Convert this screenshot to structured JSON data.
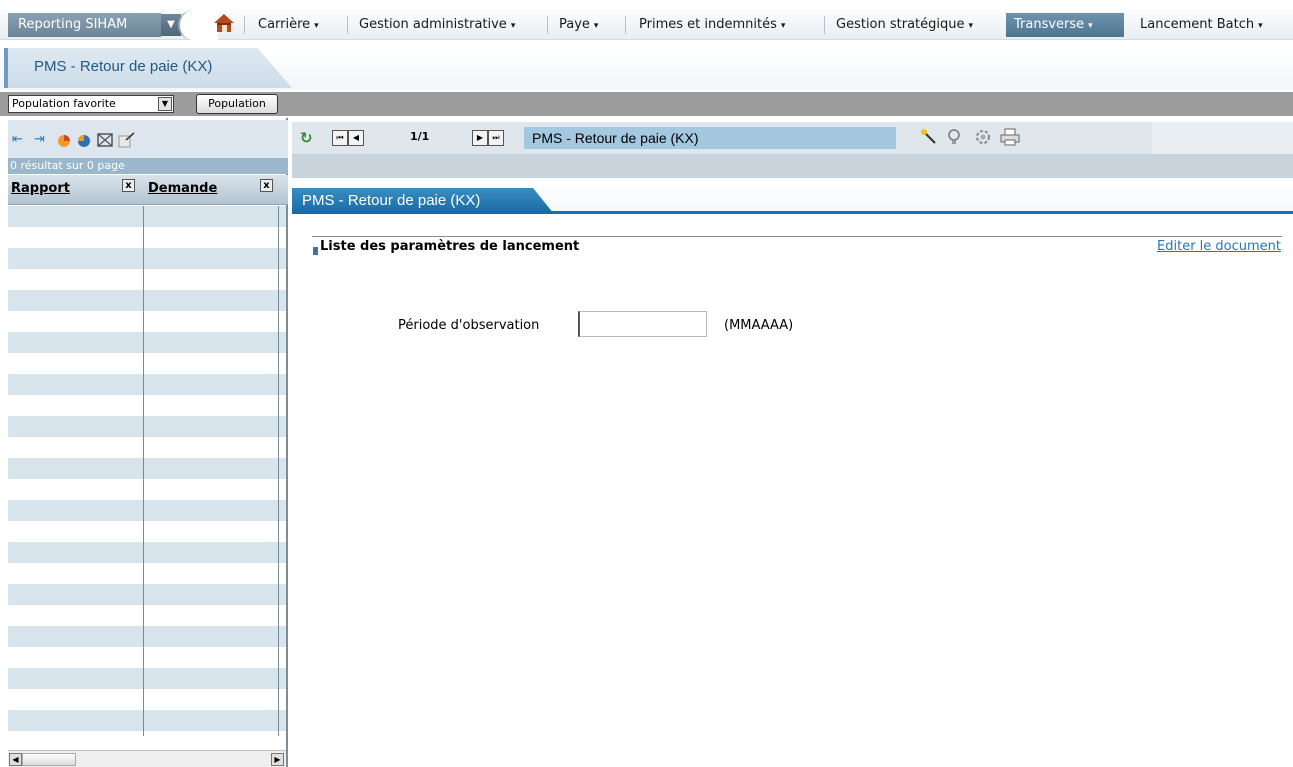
{
  "app": {
    "name": "Reporting SIHAM",
    "dropdown_glyph": "▼"
  },
  "menu": {
    "items": [
      {
        "label": "Carrière",
        "caret": "▾"
      },
      {
        "label": "Gestion administrative",
        "caret": "▾"
      },
      {
        "label": "Paye",
        "caret": "▾"
      },
      {
        "label": "Primes et indemnités",
        "caret": "▾"
      },
      {
        "label": "Gestion stratégique",
        "caret": "▾"
      },
      {
        "label": "Transverse",
        "caret": "▾",
        "active": true
      },
      {
        "label": "Lancement Batch",
        "caret": "▾"
      }
    ]
  },
  "page": {
    "title": "PMS - Retour de paie (KX)"
  },
  "population": {
    "select_value": "Population favorite",
    "button_label": "Population"
  },
  "left_panel": {
    "result_count": "0 résultat sur 0 page",
    "columns": [
      {
        "label": "Rapport",
        "remove": "x"
      },
      {
        "label": "Demande",
        "remove": "x"
      }
    ],
    "icons": [
      "first-icon",
      "last-icon",
      "pie-chart-icon",
      "pie-chart-icon-2",
      "expand-icon",
      "export-icon"
    ]
  },
  "viewer": {
    "page_indicator": "1/1",
    "document_title": "PMS - Retour de paie (KX)",
    "tab_label": "PMS - Retour de paie (KX)",
    "tools": [
      "wand-icon",
      "bulb-icon",
      "settings-icon",
      "print-icon"
    ]
  },
  "form": {
    "section_title": "Liste des paramètres de lancement",
    "edit_link": "Editer le document",
    "field_label": "Période d'observation",
    "field_value": "",
    "field_hint": "(MMAAAA)"
  },
  "colors": {
    "accent": "#1c6fa8",
    "menu_active": "#5a829e",
    "row_alt": "#d8e4ec",
    "link": "#2478b8"
  }
}
